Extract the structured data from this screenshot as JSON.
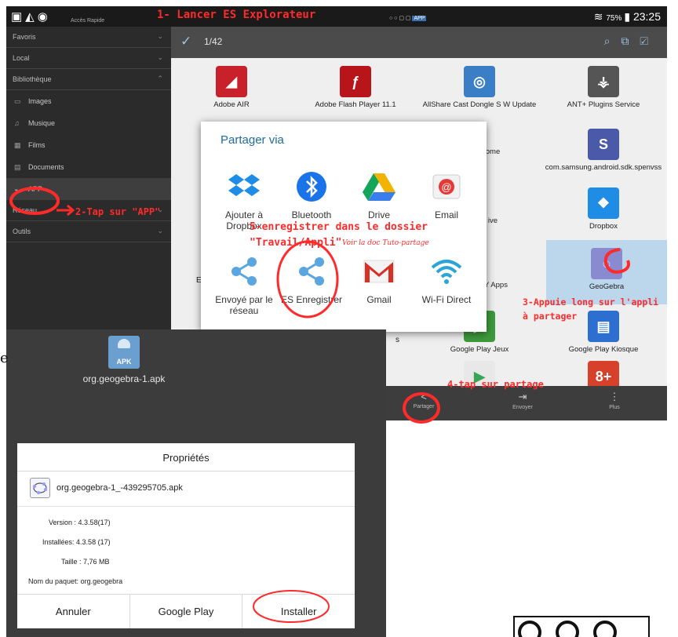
{
  "status_bar": {
    "subtitle": "Accès Rapide",
    "center_text": "APP",
    "battery": "75%",
    "time": "23:25"
  },
  "sidebar": {
    "sections": [
      {
        "label": "Favoris"
      },
      {
        "label": "Local"
      },
      {
        "label": "Bibliothèque"
      }
    ],
    "items": [
      {
        "label": "Images"
      },
      {
        "label": "Musique"
      },
      {
        "label": "Films"
      },
      {
        "label": "Documents"
      },
      {
        "label": "APP"
      }
    ],
    "bottom_sections": [
      {
        "label": "Réseau"
      },
      {
        "label": "Outils"
      }
    ]
  },
  "action_bar": {
    "count": "1/42"
  },
  "apps": [
    {
      "label": "Adobe AIR",
      "icon": "adobe-air-icon",
      "color": "#c8212b"
    },
    {
      "label": "Adobe Flash Player 11.1",
      "icon": "flash-icon",
      "color": "#b8151b"
    },
    {
      "label": "AllShare Cast Dongle S W Update",
      "icon": "allshare-icon",
      "color": "#3a7fc5"
    },
    {
      "label": "ANT+ Plugins Service",
      "icon": "ant-icon",
      "color": "#555555"
    },
    {
      "label": "ome",
      "icon": "chrome-icon",
      "color": "#e0b030"
    },
    {
      "label": "com.samsung.android.sdk.spenvss",
      "icon": "spen-icon",
      "color": "#4a5aa8"
    },
    {
      "label": "ive",
      "icon": "drive-icon",
      "color": "#f2b400"
    },
    {
      "label": "Dropbox",
      "icon": "dropbox-icon",
      "color": "#1f8ce6"
    },
    {
      "label": "Y Apps",
      "icon": "galaxy-icon",
      "color": "#555555"
    },
    {
      "label": "GeoGebra",
      "icon": "geogebra-icon",
      "color": "#8a8ad0"
    },
    {
      "label": "Google Play Jeux",
      "icon": "play-games-icon",
      "color": "#3e9a3e"
    },
    {
      "label": "Google Play Kiosque",
      "icon": "kiosque-icon",
      "color": "#2d6fd0"
    },
    {
      "label": "8+",
      "icon": "gplus-icon",
      "color": "#d7402b"
    }
  ],
  "grid_fragments": {
    "left_e": "E",
    "left_s": "s"
  },
  "share_dialog": {
    "title": "Partager via",
    "options": [
      {
        "label": "Ajouter à Dropbox",
        "icon": "dropbox-icon"
      },
      {
        "label": "Bluetooth",
        "icon": "bluetooth-icon"
      },
      {
        "label": "Drive",
        "icon": "drive-icon"
      },
      {
        "label": "Email",
        "icon": "email-icon"
      },
      {
        "label": "Envoyé par le réseau",
        "icon": "share-es-icon"
      },
      {
        "label": "ES Enregistrer",
        "icon": "share-es-icon"
      },
      {
        "label": "Gmail",
        "icon": "gmail-icon"
      },
      {
        "label": "Wi-Fi Direct",
        "icon": "wifi-direct-icon"
      }
    ]
  },
  "bottom_bar": [
    {
      "label": "Partager",
      "icon": "share-icon"
    },
    {
      "label": "Envoyer",
      "icon": "send-icon"
    },
    {
      "label": "Plus",
      "icon": "more-icon"
    }
  ],
  "apk_file": {
    "icon_text": "APK",
    "name": "org.geogebra-1.apk"
  },
  "properties": {
    "title": "Propriétés",
    "file": "org.geogebra-1_-439295705.apk",
    "rows": [
      {
        "label": "Version :",
        "value": "4.3.58(17)"
      },
      {
        "label": "Installées:",
        "value": "4.3.58 (17)"
      },
      {
        "label": "Taille :",
        "value": "7,76 MB"
      },
      {
        "label": "Nom du paquet:",
        "value": "org.geogebra"
      }
    ],
    "buttons": [
      "Annuler",
      "Google Play",
      "Installer"
    ]
  },
  "annotations": {
    "step1": "1- Lancer ES Explorateur",
    "step2": "2-Tap sur \"APP\"",
    "step3_line1": "3-Appuie long sur l'appli",
    "step3_line2": "à partager",
    "step4": "4-tap sur partage",
    "step5_line1": "5-enregistrer dans le dossier",
    "step5_line2": "\"Travail/Appli\"",
    "step5_note": "Voir la doc Tuto-partage"
  },
  "stray_text": "e",
  "colors": {
    "annotation": "#ff2a2a",
    "dialog_title": "#1f6b9c",
    "selection": "#bcd6ec"
  }
}
